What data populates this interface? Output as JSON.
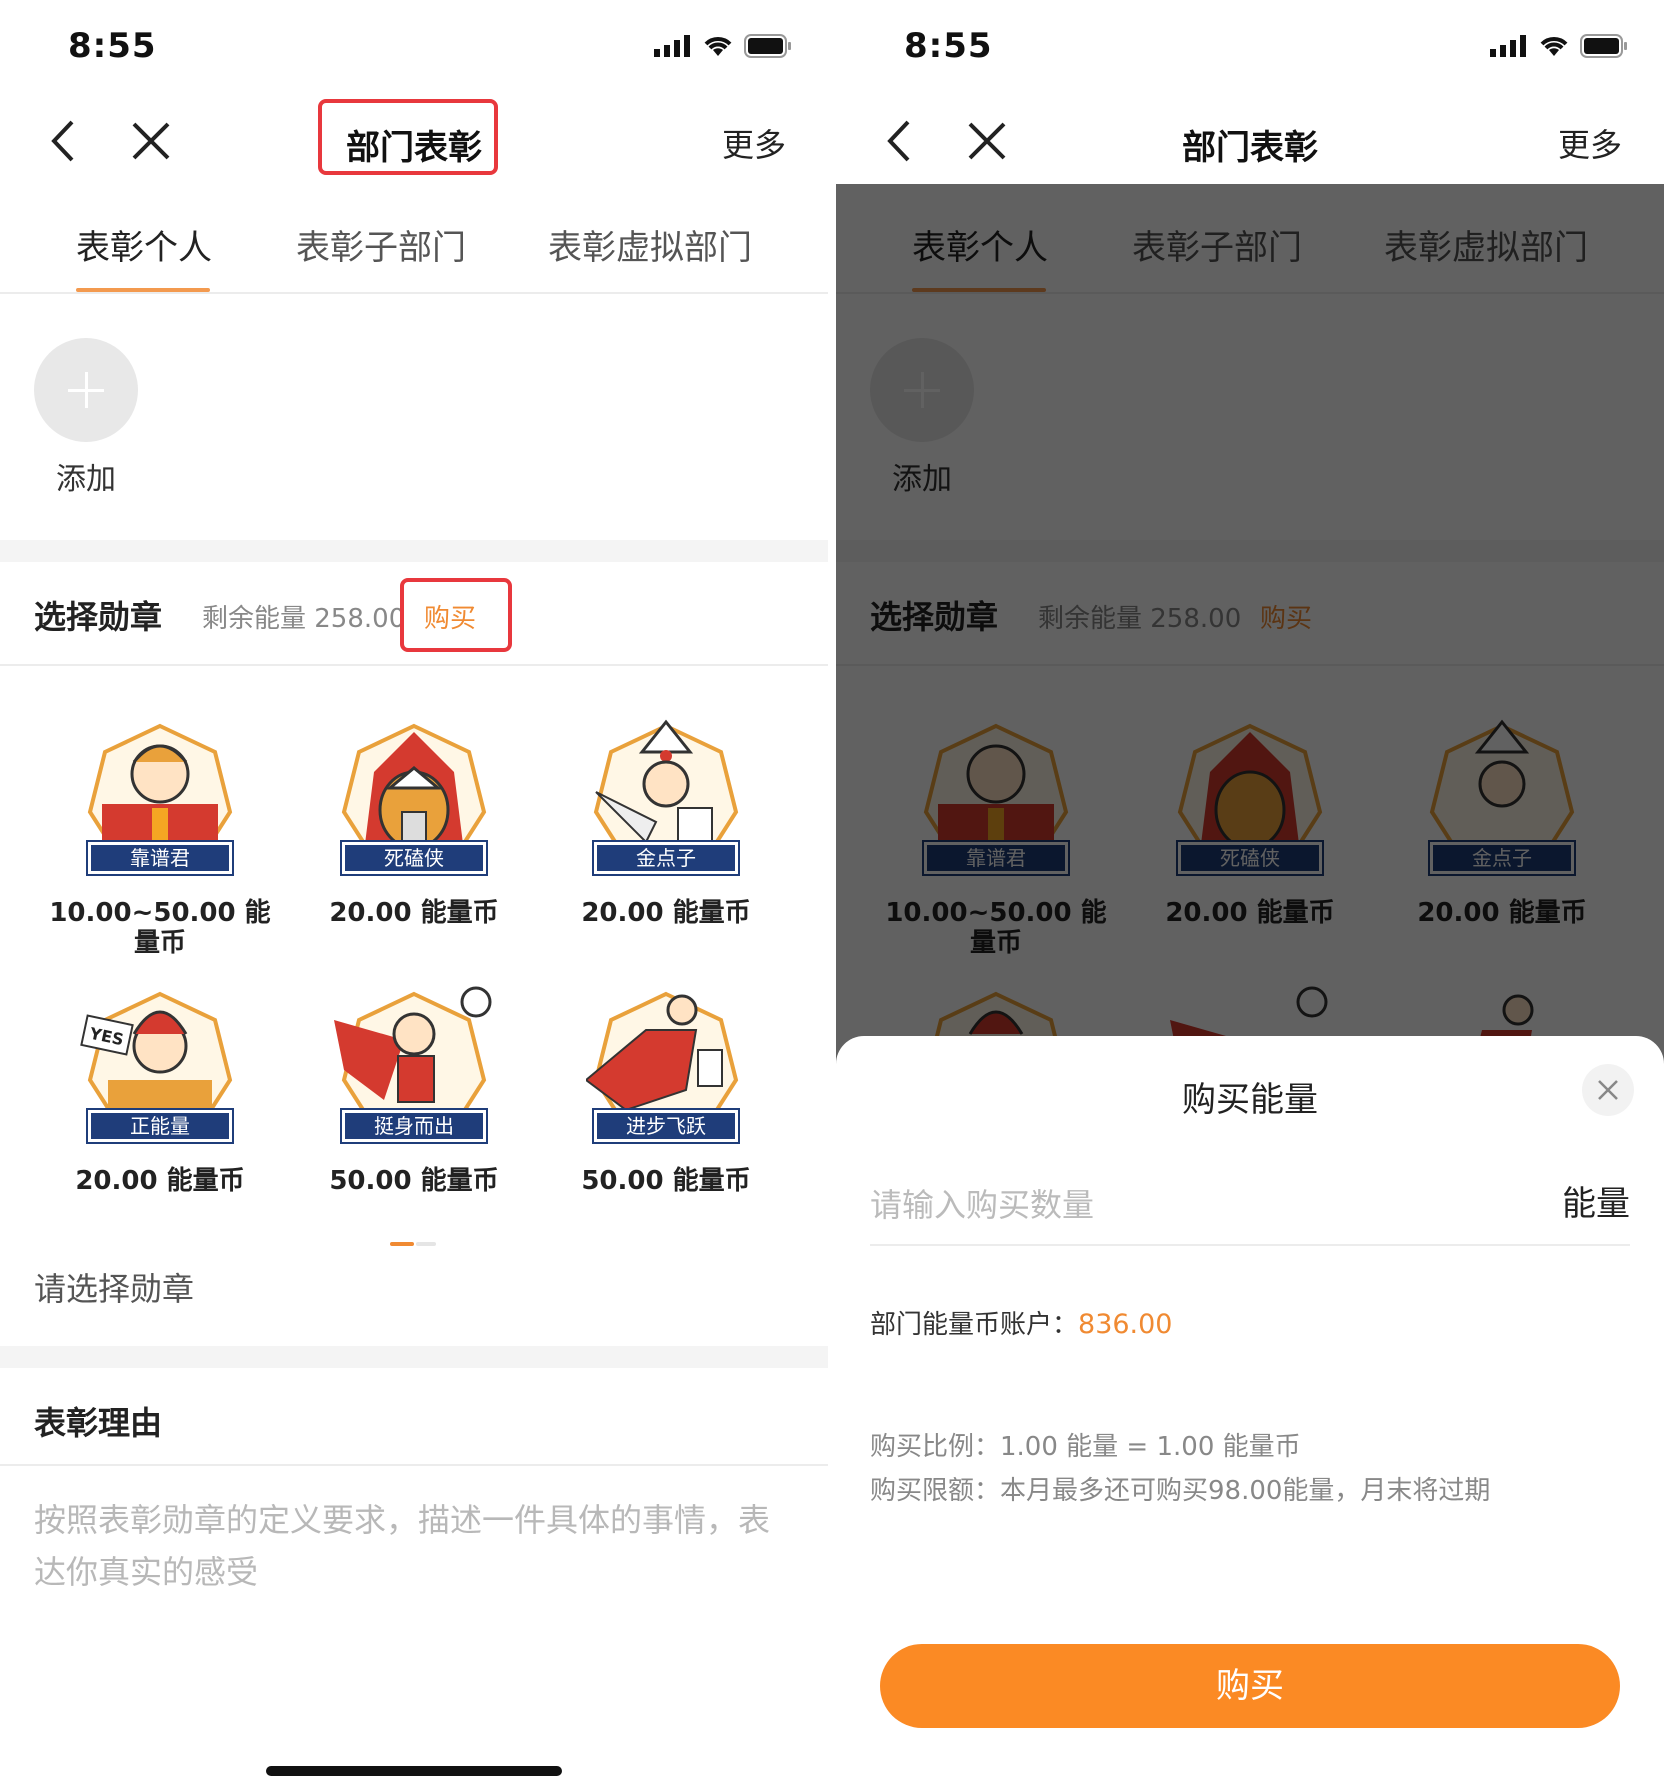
{
  "status": {
    "time": "8:55"
  },
  "nav": {
    "title": "部门表彰",
    "more": "更多"
  },
  "tabs": [
    "表彰个人",
    "表彰子部门",
    "表彰虚拟部门"
  ],
  "add": {
    "label": "添加"
  },
  "medal_section": {
    "title": "选择勋章",
    "remaining": "剩余能量 258.00",
    "buy": "购买"
  },
  "medals": [
    {
      "name": "靠谱君",
      "price": "10.00~50.00 能量币",
      "icon": "reliable-medal-icon"
    },
    {
      "name": "死磕侠",
      "price": "20.00 能量币",
      "icon": "persistent-medal-icon"
    },
    {
      "name": "金点子",
      "price": "20.00 能量币",
      "icon": "idea-medal-icon"
    },
    {
      "name": "正能量",
      "price": "20.00 能量币",
      "icon": "positive-medal-icon"
    },
    {
      "name": "挺身而出",
      "price": "50.00 能量币",
      "icon": "hero-medal-icon"
    },
    {
      "name": "进步飞跃",
      "price": "50.00 能量币",
      "icon": "progress-medal-icon"
    }
  ],
  "pick_hint": "请选择勋章",
  "reason": {
    "title": "表彰理由",
    "placeholder": "按照表彰勋章的定义要求，描述一件具体的事情，表达你真实的感受"
  },
  "sheet": {
    "title": "购买能量",
    "input_placeholder": "请输入购买数量",
    "unit": "能量",
    "account_label": "部门能量币账户：",
    "account_value": "836.00",
    "ratio": "购买比例：1.00 能量 = 1.00 能量币",
    "limit": "购买限额：本月最多还可购买98.00能量，月末将过期",
    "buy_button": "购买"
  },
  "colors": {
    "accent": "#fb8a24",
    "highlight": "#e8383d",
    "medal_tag": "#1f3d7a"
  }
}
